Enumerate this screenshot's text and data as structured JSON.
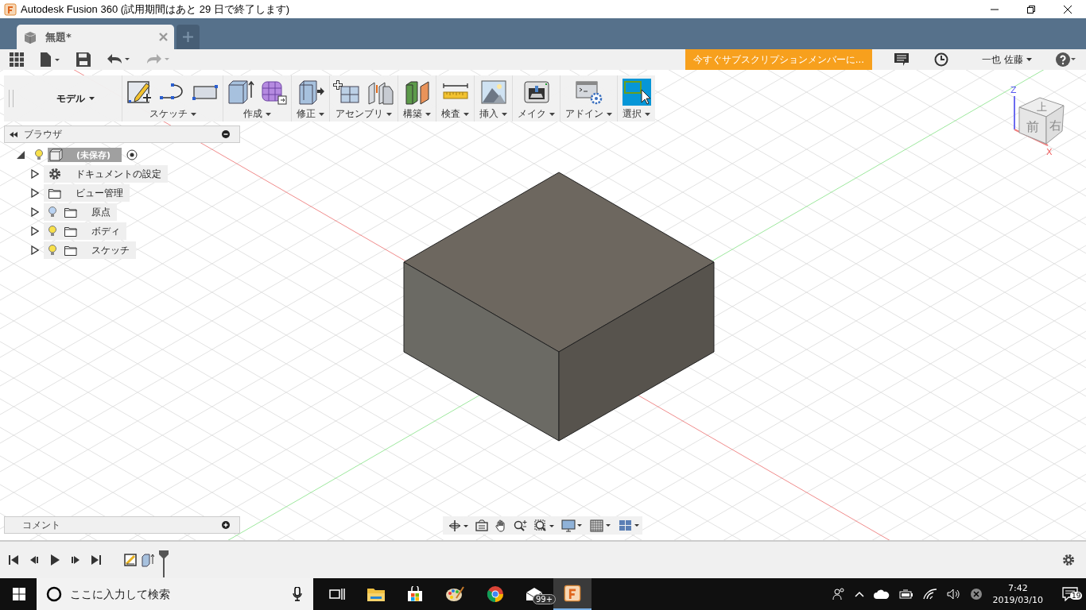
{
  "window": {
    "title": "Autodesk Fusion 360 (試用期間はあと 29 日で終了します)"
  },
  "tabs": [
    {
      "label": "無題*",
      "selected": true
    }
  ],
  "toolbar": {
    "subscribe": "今すぐサブスクリプションメンバーに...",
    "user": "一也 佐藤"
  },
  "ribbon": {
    "workspace": "モデル",
    "groups": [
      {
        "kind": "sketch",
        "label": "スケッチ",
        "active": false
      },
      {
        "kind": "create",
        "label": "作成",
        "active": false
      },
      {
        "kind": "modify",
        "label": "修正",
        "active": false
      },
      {
        "kind": "assemble",
        "label": "アセンブリ",
        "active": false
      },
      {
        "kind": "construct",
        "label": "構築",
        "active": false
      },
      {
        "kind": "inspect",
        "label": "検査",
        "active": false
      },
      {
        "kind": "insert",
        "label": "挿入",
        "active": false
      },
      {
        "kind": "make",
        "label": "メイク",
        "active": false
      },
      {
        "kind": "addins",
        "label": "アドイン",
        "active": false
      },
      {
        "kind": "select",
        "label": "選択",
        "active": true
      }
    ]
  },
  "browser": {
    "title": "ブラウザ",
    "root": {
      "label": "(未保存)",
      "visible": true,
      "expanded": true,
      "children": [
        {
          "kind": "settings",
          "label": "ドキュメントの設定",
          "expanded": false
        },
        {
          "kind": "folder",
          "label": "ビュー管理",
          "expanded": false
        },
        {
          "kind": "folder",
          "label": "原点",
          "visible": false,
          "expanded": false
        },
        {
          "kind": "folder",
          "label": "ボディ",
          "visible": true,
          "expanded": false
        },
        {
          "kind": "folder",
          "label": "スケッチ",
          "visible": true,
          "expanded": false
        }
      ]
    }
  },
  "viewcube": {
    "top": "上",
    "front": "前",
    "right": "右",
    "z_axis": "Z",
    "x_axis": "X"
  },
  "comments": {
    "title": "コメント"
  },
  "taskbar": {
    "search_placeholder": "ここに入力して検索",
    "mail_badge": "99+",
    "time": "7:42",
    "date": "2019/03/10",
    "notifications": "19"
  }
}
